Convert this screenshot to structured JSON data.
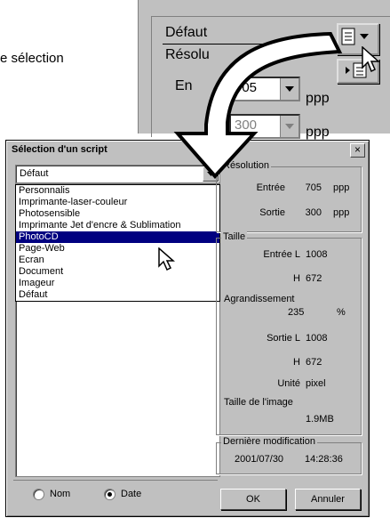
{
  "background": {
    "caption_partial": "e sélection",
    "preset_value": "Défaut",
    "resolution_label_partial": "Résolu",
    "input_label_partial": "En",
    "input_value": "705",
    "output_value": "300",
    "unit_ppp": "ppp",
    "unit_ppp_2": "ppp"
  },
  "dialog": {
    "title": "Sélection d'un script",
    "close_glyph": "×",
    "combo_value": "Défaut",
    "dropdown_items": [
      "Personnalis",
      "Imprimante-laser-couleur",
      "Photosensible",
      "Imprimante Jet d'encre & Sublimation",
      "PhotoCD",
      "Page-Web",
      "Ecran",
      "Document",
      "Imageur",
      "Défaut"
    ],
    "selected_index": 4,
    "sort": {
      "name_label": "Nom",
      "date_label": "Date",
      "selected": "Date"
    },
    "resolution": {
      "title": "Résolution",
      "input_label": "Entrée",
      "input_value": "705",
      "input_unit": "ppp",
      "output_label": "Sortie",
      "output_value": "300",
      "output_unit": "ppp"
    },
    "size": {
      "title": "Taille",
      "input_l_label": "Entrée L",
      "input_l_value": "1008",
      "input_h_label": "H",
      "input_h_value": "672",
      "enlargement_label": "Agrandissement",
      "enlargement_value": "235",
      "enlargement_unit": "%",
      "output_l_label": "Sortie L",
      "output_l_value": "1008",
      "output_h_label": "H",
      "output_h_value": "672",
      "unit_label": "Unité",
      "unit_value": "pixel",
      "image_size_label": "Taille de l'image",
      "image_size_value": "1.9MB"
    },
    "last_modified": {
      "title": "Dernière modification",
      "date": "2001/07/30",
      "time": "14:28:36"
    },
    "ok_label": "OK",
    "cancel_label": "Annuler"
  }
}
